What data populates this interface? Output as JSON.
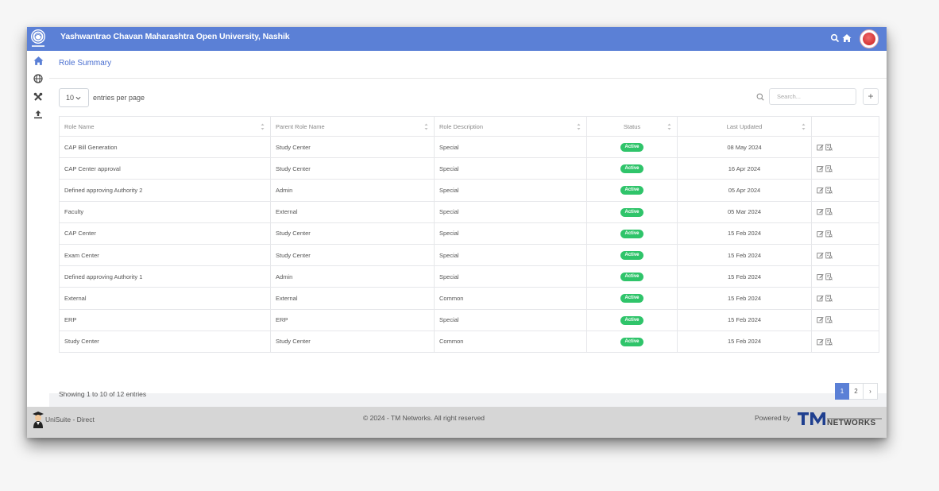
{
  "header": {
    "university_name": "Yashwantrao Chavan Maharashtra Open University, Nashik"
  },
  "page": {
    "title": "Role Summary"
  },
  "controls": {
    "entries_value": "10",
    "entries_label": "entries per page",
    "search_placeholder": "Search...",
    "add_label": "+"
  },
  "table": {
    "columns": [
      "Role Name",
      "Parent Role Name",
      "Role Description",
      "Status",
      "Last Updated"
    ],
    "rows": [
      {
        "role": "CAP Bill Generation",
        "parent": "Study Center",
        "desc": "Special",
        "status": "Active",
        "updated": "08 May 2024"
      },
      {
        "role": "CAP Center approval",
        "parent": "Study Center",
        "desc": "Special",
        "status": "Active",
        "updated": "16 Apr 2024"
      },
      {
        "role": "Defined approving Authority 2",
        "parent": "Admin",
        "desc": "Special",
        "status": "Active",
        "updated": "05 Apr 2024"
      },
      {
        "role": "Faculty",
        "parent": "External",
        "desc": "Special",
        "status": "Active",
        "updated": "05 Mar 2024"
      },
      {
        "role": "CAP Center",
        "parent": "Study Center",
        "desc": "Special",
        "status": "Active",
        "updated": "15 Feb 2024"
      },
      {
        "role": "Exam Center",
        "parent": "Study Center",
        "desc": "Special",
        "status": "Active",
        "updated": "15 Feb 2024"
      },
      {
        "role": "Defined approving Authority 1",
        "parent": "Admin",
        "desc": "Special",
        "status": "Active",
        "updated": "15 Feb 2024"
      },
      {
        "role": "External",
        "parent": "External",
        "desc": "Common",
        "status": "Active",
        "updated": "15 Feb 2024"
      },
      {
        "role": "ERP",
        "parent": "ERP",
        "desc": "Special",
        "status": "Active",
        "updated": "15 Feb 2024"
      },
      {
        "role": "Study Center",
        "parent": "Study Center",
        "desc": "Common",
        "status": "Active",
        "updated": "15 Feb 2024"
      }
    ]
  },
  "pagination": {
    "info": "Showing 1 to 10 of 12 entries",
    "pages": [
      "1",
      "2"
    ],
    "next": "›"
  },
  "footer": {
    "brand": "UniSuite - Direct",
    "copyright": "© 2024 - TM Networks. All right reserved",
    "powered_by": "Powered by"
  },
  "colors": {
    "primary": "#5b80d6",
    "active_badge": "#2fc46a",
    "title_link": "#4a6fd0"
  },
  "icons": {
    "sidebar": [
      "home-icon",
      "globe-icon",
      "tools-icon",
      "upload-icon"
    ],
    "row_actions": [
      "edit-icon",
      "view-details-icon"
    ]
  }
}
